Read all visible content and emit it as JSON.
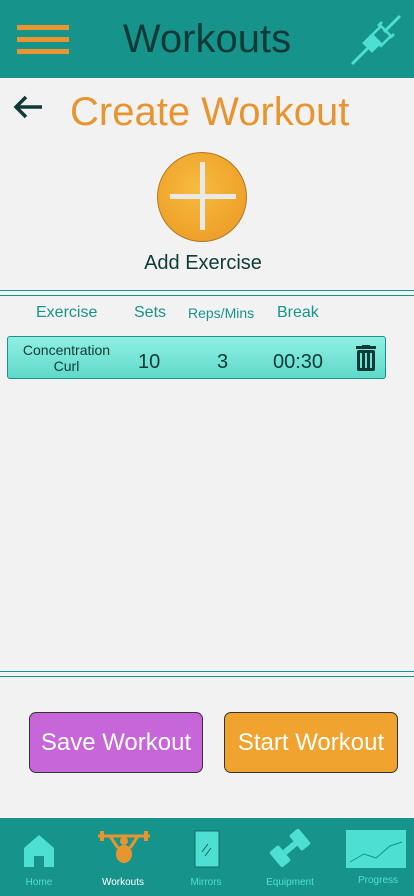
{
  "header": {
    "title": "Workouts"
  },
  "page": {
    "title": "Create Workout",
    "add_exercise_label": "Add Exercise"
  },
  "table": {
    "headers": [
      "Exercise",
      "Sets",
      "Reps/Mins",
      "Break"
    ],
    "rows": [
      {
        "exercise_line1": "Concentration",
        "exercise_line2": "Curl",
        "sets": "10",
        "reps": "3",
        "break": "00:30"
      }
    ]
  },
  "actions": {
    "save_label": "Save Workout",
    "start_label": "Start Workout"
  },
  "nav": {
    "items": [
      {
        "label": "Home",
        "icon": "home-icon"
      },
      {
        "label": "Workouts",
        "icon": "weightlifter-icon",
        "active": true
      },
      {
        "label": "Mirrors",
        "icon": "mirror-icon"
      },
      {
        "label": "Equipment",
        "icon": "dumbbell-icon"
      },
      {
        "label": "Progress",
        "icon": "progress-chart-icon"
      }
    ]
  },
  "colors": {
    "primary": "#16948c",
    "accent": "#e8952f",
    "save": "#c766d9",
    "start": "#f0a32e",
    "row": "#6fe3d4"
  }
}
